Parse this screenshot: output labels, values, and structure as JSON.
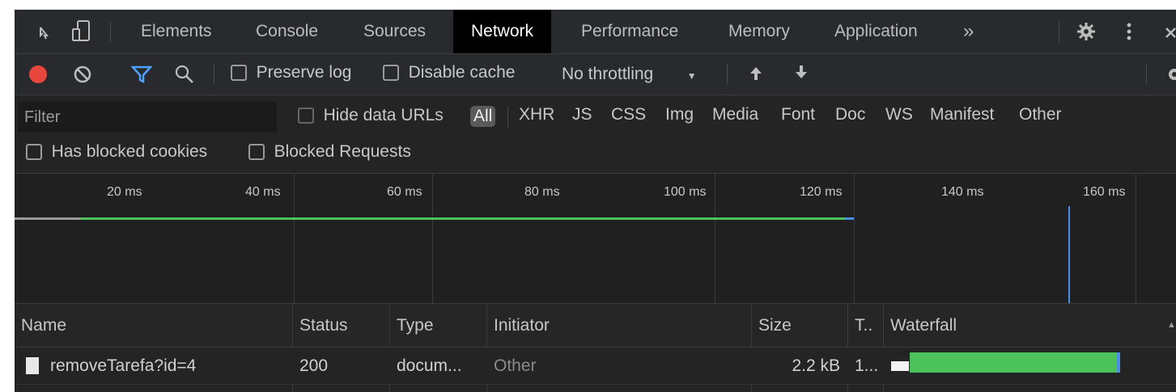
{
  "tabs": {
    "elements": "Elements",
    "console": "Console",
    "sources": "Sources",
    "network": "Network",
    "performance": "Performance",
    "memory": "Memory",
    "application": "Application",
    "more": "»"
  },
  "toolbar": {
    "preserve_log": "Preserve log",
    "disable_cache": "Disable cache",
    "throttling": "No throttling"
  },
  "filter": {
    "placeholder": "Filter",
    "hide_data_urls": "Hide data URLs",
    "types": [
      "All",
      "XHR",
      "JS",
      "CSS",
      "Img",
      "Media",
      "Font",
      "Doc",
      "WS",
      "Manifest",
      "Other"
    ],
    "has_blocked_cookies": "Has blocked cookies",
    "blocked_requests": "Blocked Requests"
  },
  "timeline": {
    "ticks": [
      "20 ms",
      "40 ms",
      "60 ms",
      "80 ms",
      "100 ms",
      "120 ms",
      "140 ms",
      "160 ms"
    ]
  },
  "table": {
    "headers": [
      "Name",
      "Status",
      "Type",
      "Initiator",
      "Size",
      "T..",
      "Waterfall"
    ],
    "rows": [
      {
        "name": "removeTarefa?id=4",
        "status": "200",
        "type": "docum...",
        "initiator": "Other",
        "size": "2.2 kB",
        "time": "1..."
      }
    ]
  },
  "colors": {
    "record": "#e8463c",
    "filter_accent": "#4da3ff",
    "waterfall_bar": "#4cc25a",
    "load_line": "#4a90e2"
  }
}
